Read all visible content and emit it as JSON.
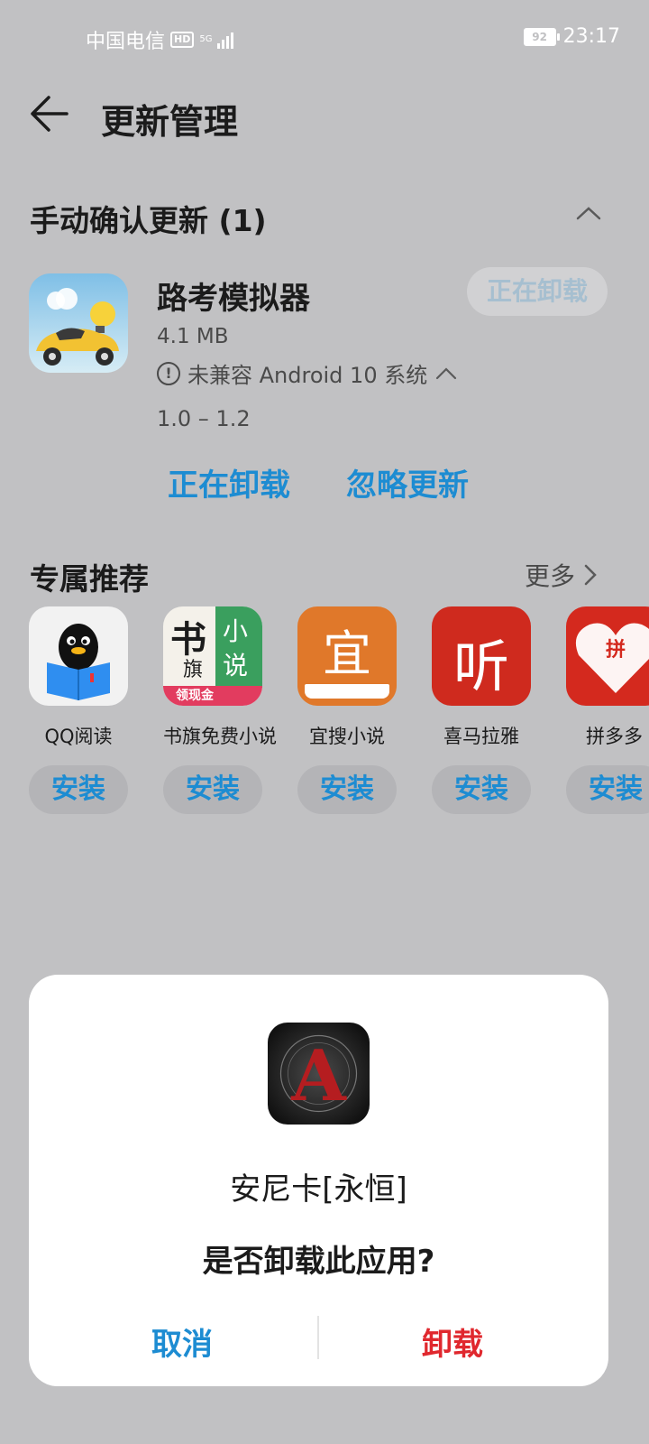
{
  "status_bar": {
    "carrier": "中国电信",
    "hd": "HD",
    "network": "5G",
    "battery": "92",
    "time": "23:17"
  },
  "header": {
    "title": "更新管理"
  },
  "manual_update": {
    "section_title": "手动确认更新 (1)",
    "app": {
      "name": "路考模拟器",
      "size": "4.1 MB",
      "compat_note": "未兼容 Android 10 系统",
      "status_button": "正在卸载",
      "version": "1.0 – 1.2",
      "action_primary": "正在卸载",
      "action_secondary": "忽略更新"
    }
  },
  "recommend": {
    "title": "专属推荐",
    "more": "更多",
    "items": [
      {
        "name": "QQ阅读",
        "install": "安装"
      },
      {
        "name": "书旗免费小说",
        "install": "安装",
        "icon_text_1": "书",
        "icon_text_2": "旗",
        "icon_text_3": "小",
        "icon_text_4": "说",
        "icon_text_5": "领现金"
      },
      {
        "name": "宜搜小说",
        "install": "安装",
        "icon_text": "宜"
      },
      {
        "name": "喜马拉雅",
        "install": "安装",
        "icon_text": "听"
      },
      {
        "name": "拼多多",
        "install": "安装",
        "icon_text": "拼"
      }
    ]
  },
  "dialog": {
    "app_name": "安尼卡[永恒]",
    "icon_letter": "A",
    "question": "是否卸载此应用?",
    "cancel": "取消",
    "confirm": "卸载",
    "colors": {
      "cancel": "#1d8cd2",
      "confirm": "#e0282e"
    }
  }
}
